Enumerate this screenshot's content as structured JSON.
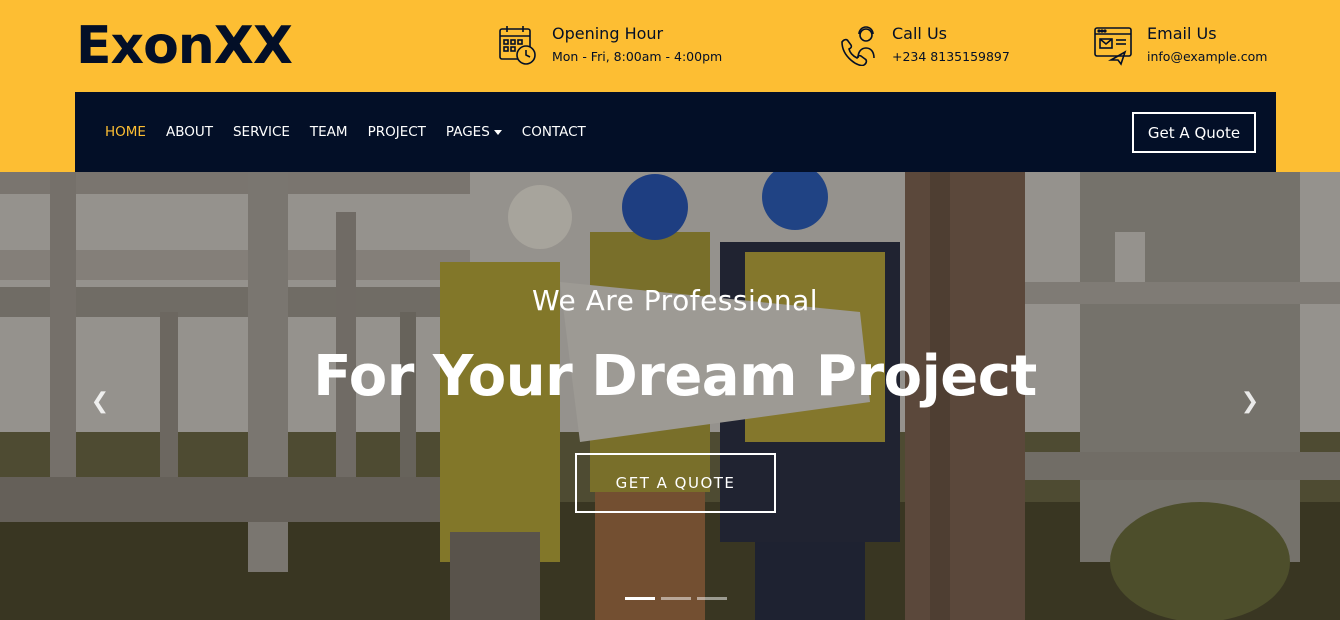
{
  "brand": {
    "name": "ExonXX"
  },
  "header": {
    "hours": {
      "title": "Opening Hour",
      "detail": "Mon - Fri, 8:00am - 4:00pm",
      "icon": "calendar-clock-icon"
    },
    "call": {
      "title": "Call Us",
      "detail": "+234 8135159897",
      "icon": "support-phone-icon"
    },
    "email": {
      "title": "Email Us",
      "detail": "info@example.com",
      "icon": "email-icon"
    }
  },
  "nav": {
    "items": [
      {
        "label": "HOME",
        "active": true
      },
      {
        "label": "ABOUT"
      },
      {
        "label": "SERVICE"
      },
      {
        "label": "TEAM"
      },
      {
        "label": "PROJECT"
      },
      {
        "label": "PAGES",
        "dropdown": true
      },
      {
        "label": "CONTACT"
      }
    ],
    "quote_label": "Get A Quote"
  },
  "hero": {
    "subtitle": "We Are Professional",
    "title": "For Your Dream Project",
    "cta_label": "GET A QUOTE",
    "prev_icon": "chevron-left-icon",
    "next_icon": "chevron-right-icon",
    "slides": 3,
    "active_slide": 1
  },
  "colors": {
    "accent": "#fdbe33",
    "dark": "#030f27",
    "white": "#ffffff"
  }
}
